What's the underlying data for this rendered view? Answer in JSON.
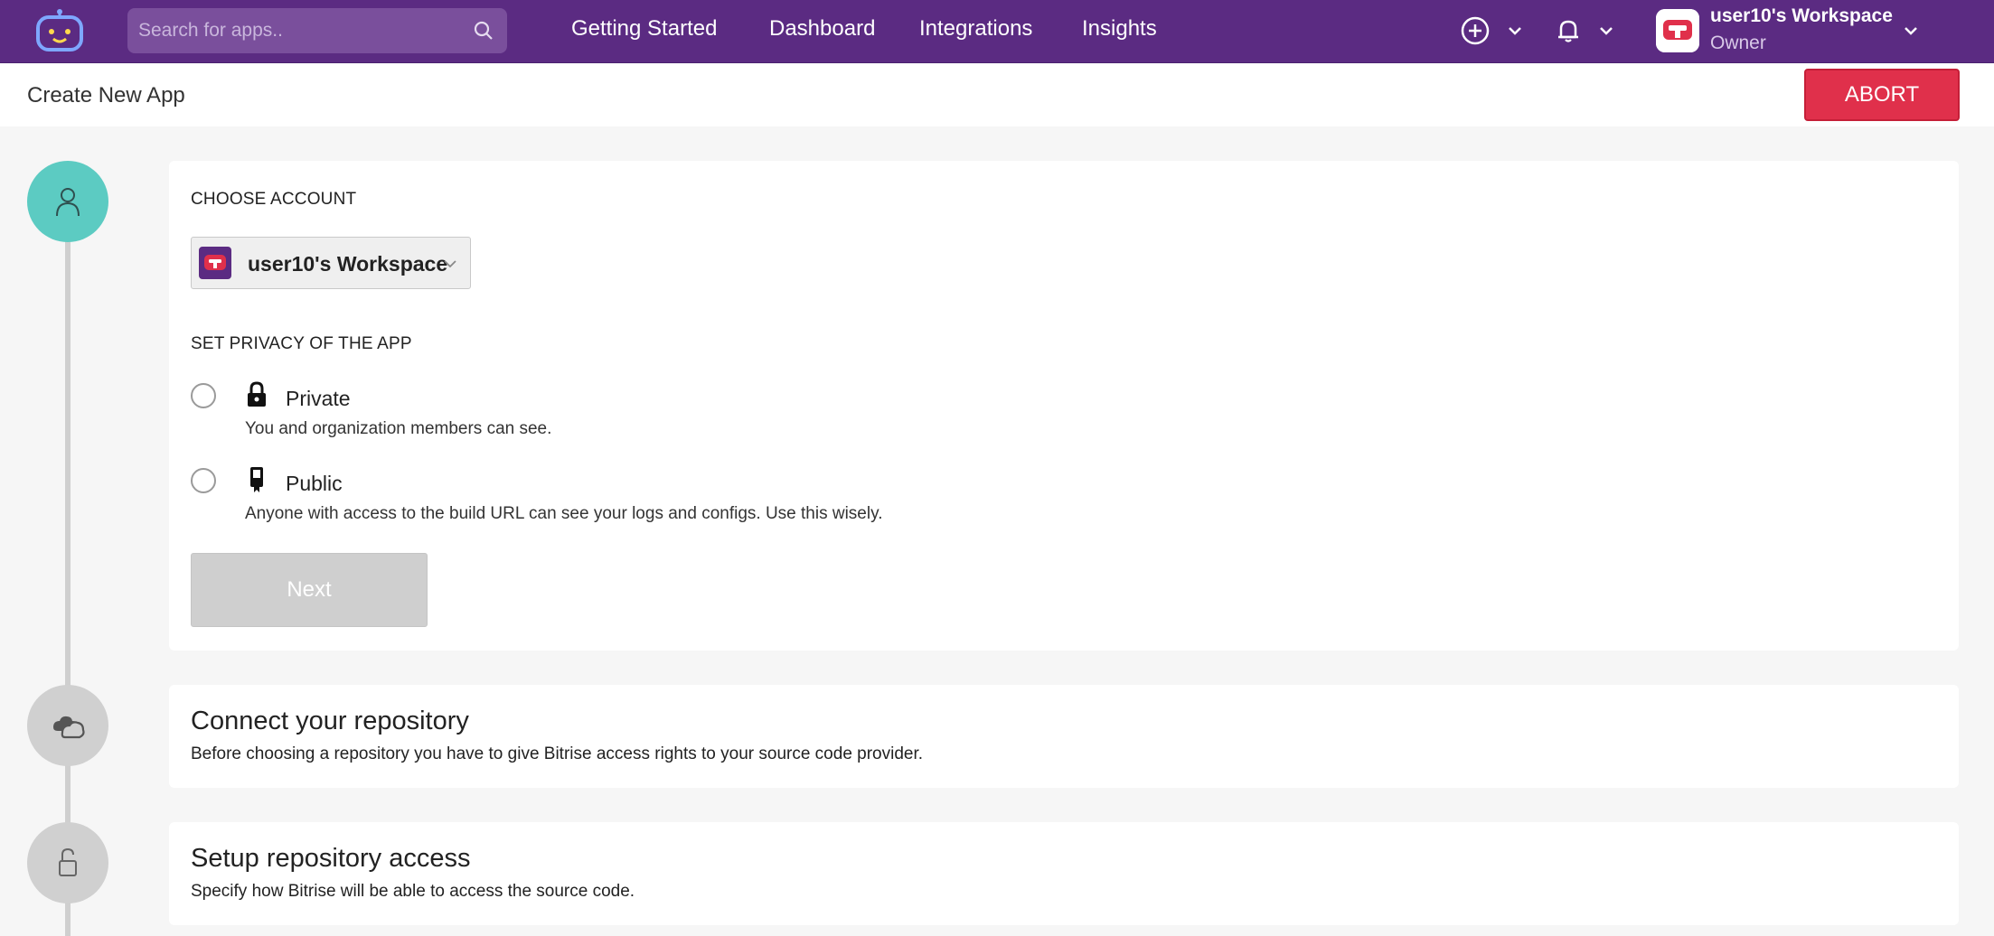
{
  "topbar": {
    "search_placeholder": "Search for apps..",
    "nav": [
      "Getting Started",
      "Dashboard",
      "Integrations",
      "Insights"
    ],
    "workspace_name": "user10's Workspace",
    "workspace_role": "Owner"
  },
  "header": {
    "title": "Create New App",
    "abort_label": "ABORT"
  },
  "step1": {
    "choose_account_label": "CHOOSE ACCOUNT",
    "selected_account": "user10's Workspace",
    "privacy_label": "SET PRIVACY OF THE APP",
    "options": [
      {
        "title": "Private",
        "desc": "You and organization members can see.",
        "icon": "lock-icon"
      },
      {
        "title": "Public",
        "desc": "Anyone with access to the build URL can see your logs and configs. Use this wisely.",
        "icon": "badge-icon"
      }
    ],
    "next_label": "Next"
  },
  "step2": {
    "title": "Connect your repository",
    "desc": "Before choosing a repository you have to give Bitrise access rights to your source code provider."
  },
  "step3": {
    "title": "Setup repository access",
    "desc": "Specify how Bitrise will be able to access the source code."
  },
  "colors": {
    "topbar": "#5b2b82",
    "abort": "#e0304b",
    "active_step": "#5ccbc2"
  }
}
